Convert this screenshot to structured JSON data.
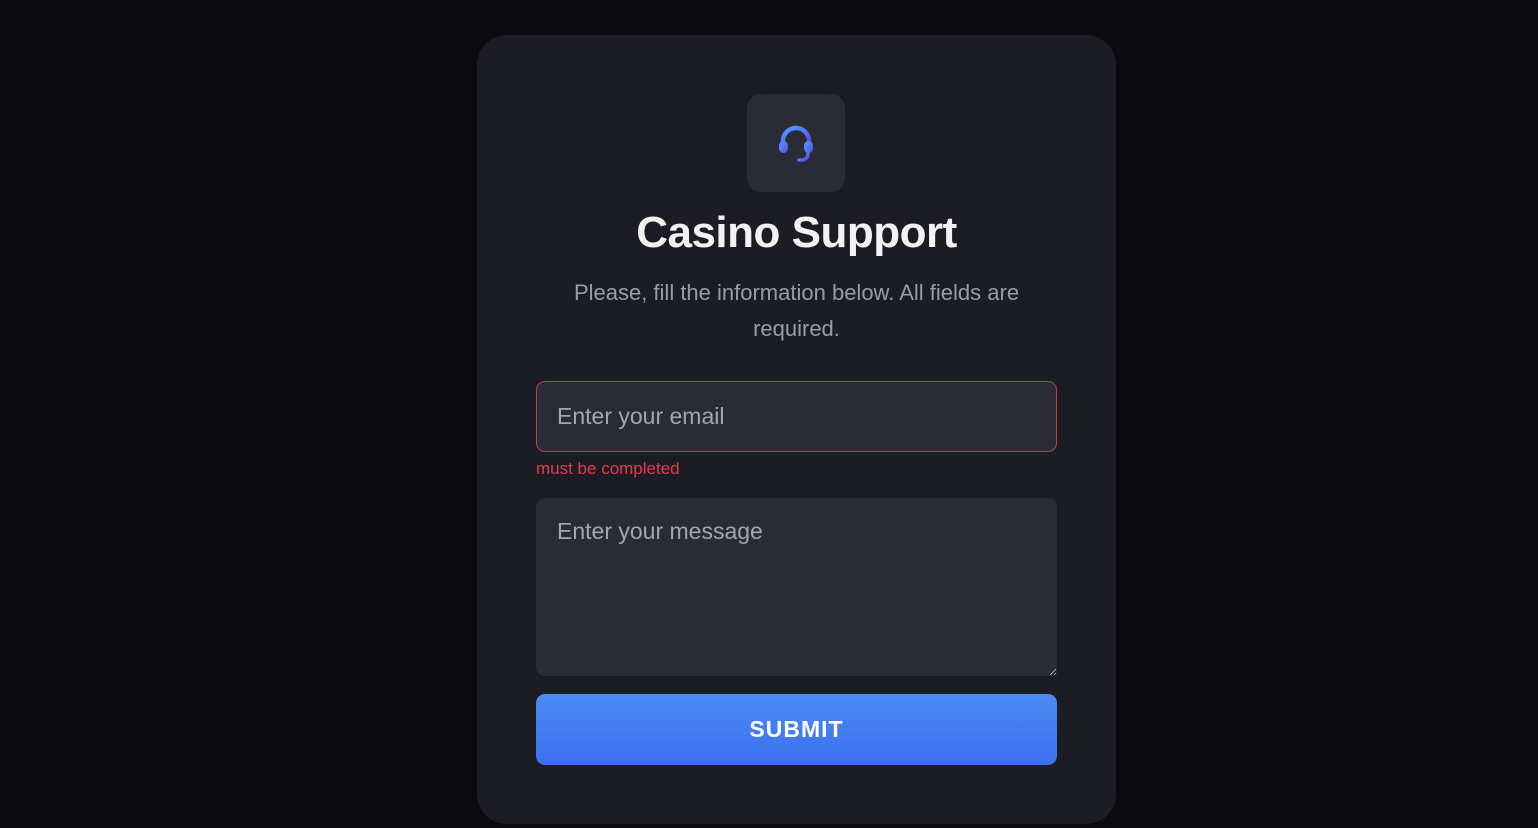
{
  "header": {
    "icon": "headset-icon",
    "title": "Casino Support",
    "subtitle": "Please, fill the information below. All fields are required."
  },
  "form": {
    "email": {
      "value": "",
      "placeholder": "Enter your email",
      "error": "must be completed"
    },
    "message": {
      "value": "",
      "placeholder": "Enter your message"
    },
    "submit_label": "SUBMIT"
  },
  "colors": {
    "background": "#0b0b0f",
    "card": "#1c1d24",
    "field": "#2a2c35",
    "error": "#e33a4c",
    "accent": "#4a8cf3"
  }
}
